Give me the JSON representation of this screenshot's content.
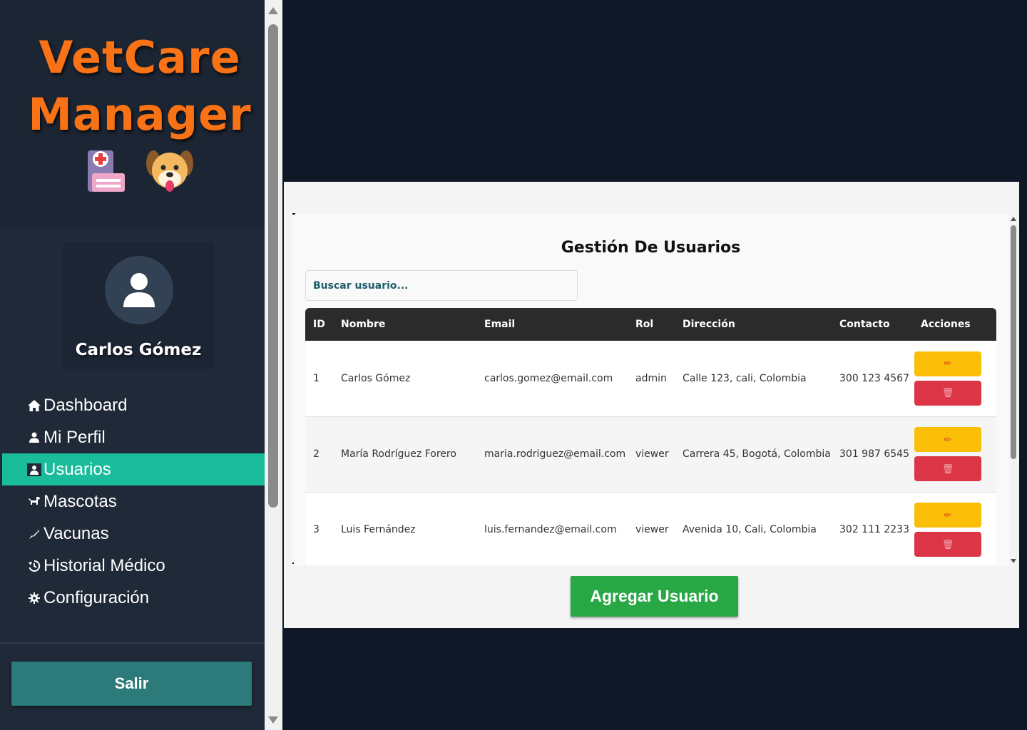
{
  "app": {
    "logo_line1": "VetCare",
    "logo_line2": "Manager"
  },
  "profile": {
    "name": "Carlos Gómez"
  },
  "nav": {
    "items": [
      {
        "label": "Dashboard",
        "icon": "home-icon",
        "active": false
      },
      {
        "label": "Mi Perfil",
        "icon": "user-icon",
        "active": false
      },
      {
        "label": "Usuarios",
        "icon": "user-card-icon",
        "active": true
      },
      {
        "label": "Mascotas",
        "icon": "dog-icon",
        "active": false
      },
      {
        "label": "Vacunas",
        "icon": "syringe-icon",
        "active": false
      },
      {
        "label": "Historial Médico",
        "icon": "history-icon",
        "active": false
      },
      {
        "label": "Configuración",
        "icon": "gear-icon",
        "active": false
      }
    ],
    "logout_label": "Salir"
  },
  "main": {
    "title": "Gestión De Usuarios",
    "search_placeholder": "Buscar usuario...",
    "add_button": "Agregar Usuario",
    "table": {
      "headers": [
        "ID",
        "Nombre",
        "Email",
        "Rol",
        "Dirección",
        "Contacto",
        "Acciones"
      ],
      "rows": [
        {
          "id": "1",
          "nombre": "Carlos Gómez",
          "email": "carlos.gomez@email.com",
          "rol": "admin",
          "direccion": "Calle 123, cali, Colombia",
          "contacto": "300 123 4567"
        },
        {
          "id": "2",
          "nombre": "María Rodríguez Forero",
          "email": "maria.rodriguez@email.com",
          "rol": "viewer",
          "direccion": "Carrera 45, Bogotá, Colombia",
          "contacto": "301 987 6545"
        },
        {
          "id": "3",
          "nombre": "Luis Fernández",
          "email": "luis.fernandez@email.com",
          "rol": "viewer",
          "direccion": "Avenida 10, Cali, Colombia",
          "contacto": "302 111 2233"
        }
      ]
    }
  },
  "colors": {
    "background": "#101828",
    "sidebar": "#1f2937",
    "accent_active": "#1abc9c",
    "logo": "#f97316",
    "logout": "#2d7a7a",
    "add": "#28a745",
    "edit": "#fbbf09",
    "delete": "#dc3545"
  }
}
